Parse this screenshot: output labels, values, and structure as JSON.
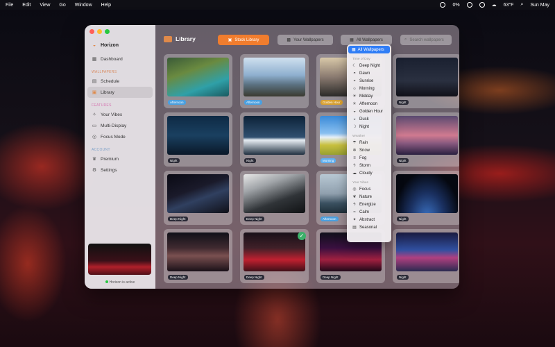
{
  "menubar": {
    "items": [
      "File",
      "Edit",
      "View",
      "Go",
      "Window",
      "Help"
    ],
    "battery": "0%",
    "weather": "63°F",
    "clock": "Sun May"
  },
  "sidebar": {
    "app_title": "Horizon",
    "dashboard": "Dashboard",
    "section_wallpapers": "WALLPAPERS",
    "schedule": "Schedule",
    "library": "Library",
    "section_features": "FEATURES",
    "your_vibes": "Your Vibes",
    "multi_display": "Multi-Display",
    "focus_mode": "Focus Mode",
    "section_account": "ACCOUNT",
    "premium": "Premium",
    "settings": "Settings",
    "status": "Horizon is active"
  },
  "toolbar": {
    "title": "Library",
    "stock_library": "Stock Library",
    "your_wallpapers": "Your Wallpapers",
    "all_wallpapers": "All Wallpapers",
    "search_placeholder": "Search wallpapers"
  },
  "dropdown": {
    "selected": "All Wallpapers",
    "section_time": "Time of Day",
    "time_items": [
      {
        "label": "Deep Night",
        "icon": "moon-stars-icon"
      },
      {
        "label": "Dawn",
        "icon": "sunrise-icon"
      },
      {
        "label": "Sunrise",
        "icon": "sunrise-icon"
      },
      {
        "label": "Morning",
        "icon": "sun-haze-icon"
      },
      {
        "label": "Midday",
        "icon": "sun-icon"
      },
      {
        "label": "Afternoon",
        "icon": "sun-icon"
      },
      {
        "label": "Golden Hour",
        "icon": "sunset-icon"
      },
      {
        "label": "Dusk",
        "icon": "sunset-icon"
      },
      {
        "label": "Night",
        "icon": "moon-icon"
      }
    ],
    "section_weather": "Weather",
    "weather_items": [
      {
        "label": "Rain",
        "icon": "rain-icon"
      },
      {
        "label": "Snow",
        "icon": "snow-icon"
      },
      {
        "label": "Fog",
        "icon": "fog-icon"
      },
      {
        "label": "Storm",
        "icon": "storm-icon"
      },
      {
        "label": "Cloudy",
        "icon": "cloud-icon"
      }
    ],
    "section_vibes": "Your Vibes",
    "vibe_items": [
      {
        "label": "Focus",
        "icon": "target-icon"
      },
      {
        "label": "Nature",
        "icon": "leaf-icon"
      },
      {
        "label": "Energize",
        "icon": "bolt-icon"
      },
      {
        "label": "Calm",
        "icon": "waves-icon"
      },
      {
        "label": "Abstract",
        "icon": "sparkle-icon"
      },
      {
        "label": "Seasonal",
        "icon": "calendar-icon"
      }
    ]
  },
  "cards": [
    {
      "label": "Afternoon",
      "kind": "afternoon",
      "bg": "linear-gradient(160deg,#3a5a38 0%,#6a8a40 35%,#2fa0a8 70%,#1a5a60 100%)"
    },
    {
      "label": "Afternoon",
      "kind": "afternoon",
      "bg": "linear-gradient(180deg,#cfe0ef 0%,#8fb0cf 45%,#5a7080 70%,#3a3a30 100%)"
    },
    {
      "label": "Golden Hour",
      "kind": "golden",
      "bg": "linear-gradient(180deg,#d8c8a8 0%,#8a7a70 50%,#2a2a28 100%)"
    },
    {
      "label": "Night",
      "kind": "night",
      "bg": "linear-gradient(180deg,#1a2030 0%,#2a3040 60%,#101018 100%)"
    },
    {
      "label": "Night",
      "kind": "night",
      "bg": "linear-gradient(180deg,#0e2a44 0%,#1a4060 50%,#0a1828 100%)"
    },
    {
      "label": "Night",
      "kind": "night",
      "bg": "linear-gradient(180deg,#0c2238 0%,#305070 55%,#e8eef4 62%,#203040 100%)"
    },
    {
      "label": "Morning",
      "kind": "morning",
      "bg": "linear-gradient(180deg,#3a8ad8 0%,#8ac0f0 45%,#e8f0f8 55%,#c8c040 75%,#98a030 100%)"
    },
    {
      "label": "Night",
      "kind": "night",
      "bg": "linear-gradient(180deg,#5a4a70 0%,#d07a90 50%,#8a5a80 70%,#2a2040 100%)"
    },
    {
      "label": "Deep Night",
      "kind": "deep",
      "bg": "linear-gradient(160deg,#0a0a14 0%,#1a1a2a 40%,#304060 60%,#101018 100%)"
    },
    {
      "label": "Deep Night",
      "kind": "deep",
      "bg": "linear-gradient(160deg,#e8e8e8 0%,#a0a4a8 30%,#303438 65%,#101214 100%)"
    },
    {
      "label": "Afternoon",
      "kind": "afternoon",
      "bg": "linear-gradient(180deg,#b8c8d4 0%,#90a0ae 50%,#3a5060 75%,#20303a 100%)"
    },
    {
      "label": "Night",
      "kind": "night",
      "bg": "radial-gradient(ellipse at 50% 110%,#3a70c0 0%,#1a3060 40%,#050810 75%)"
    },
    {
      "label": "Deep Night",
      "kind": "deep",
      "bg": "linear-gradient(180deg,#101018 0%,#402a30 40%,#7a5050 60%,#1a1018 100%)"
    },
    {
      "label": "Deep Night",
      "kind": "deep",
      "bg": "linear-gradient(180deg,#181018 0%,#402028 40%,#c02030 70%,#401018 100%)"
    },
    {
      "label": "Deep Night",
      "kind": "deep",
      "bg": "linear-gradient(180deg,#10101a 0%,#3a1040 40%,#a02040 70%,#200818 100%)"
    },
    {
      "label": "Night",
      "kind": "night",
      "bg": "linear-gradient(180deg,#1a1a40 0%,#3050a0 45%,#b04080 65%,#2a2a50 100%)"
    }
  ],
  "selected_card_check": "✓"
}
